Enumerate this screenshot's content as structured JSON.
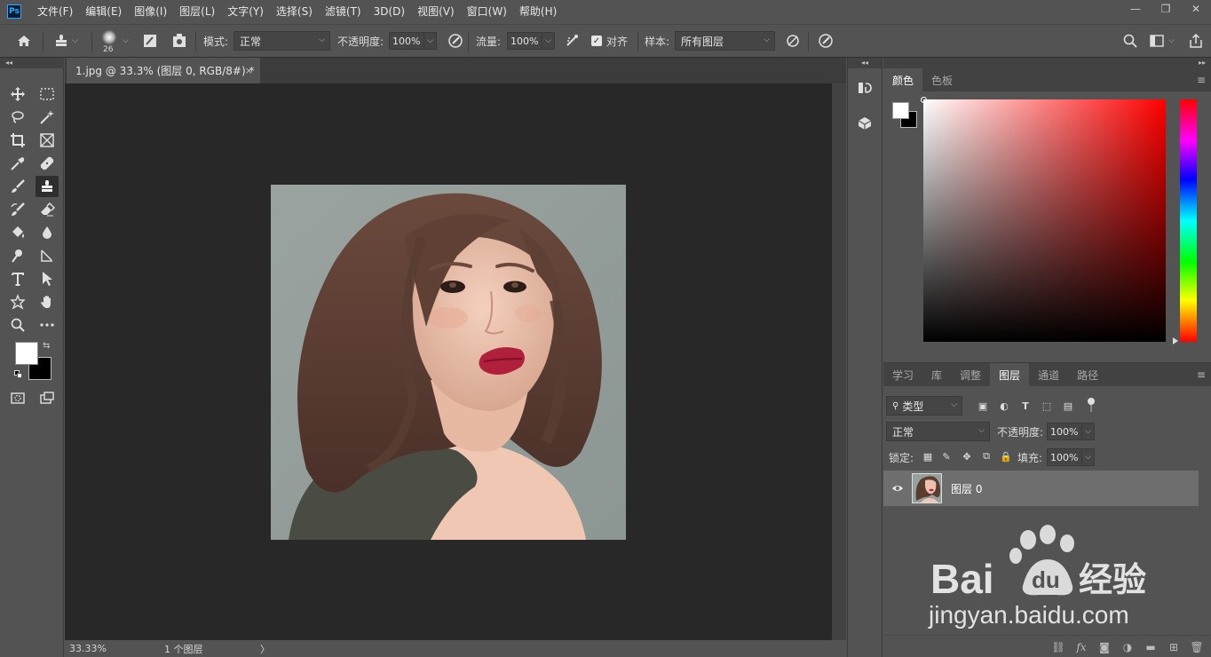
{
  "app": {
    "logo_text": "Ps"
  },
  "menu": {
    "items": [
      "文件(F)",
      "编辑(E)",
      "图像(I)",
      "图层(L)",
      "文字(Y)",
      "选择(S)",
      "滤镜(T)",
      "3D(D)",
      "视图(V)",
      "窗口(W)",
      "帮助(H)"
    ]
  },
  "window_controls": {
    "minimize": "—",
    "restore": "❐",
    "close": "✕"
  },
  "options_bar": {
    "brush_size": "26",
    "mode_label": "模式:",
    "mode_value": "正常",
    "opacity_label": "不透明度:",
    "opacity_value": "100%",
    "flow_label": "流量:",
    "flow_value": "100%",
    "aligned_checked": true,
    "aligned_label": "对齐",
    "sample_label": "样本:",
    "sample_value": "所有图层"
  },
  "document": {
    "tab_title": "1.jpg @ 33.3% (图层 0, RGB/8#) *",
    "close_glyph": "×"
  },
  "status_bar": {
    "zoom": "33.33%",
    "info": "1 个图层",
    "arrow": "〉"
  },
  "tools": {
    "active": "clone-stamp-tool",
    "foreground_color": "#ffffff",
    "background_color": "#000000"
  },
  "color_panel": {
    "tabs": [
      "颜色",
      "色板"
    ],
    "active_tab": "颜色",
    "hue_color": "#ff0000"
  },
  "layers_panel": {
    "tabs": [
      "学习",
      "库",
      "调整",
      "图层",
      "通道",
      "路径"
    ],
    "active_tab": "图层",
    "filter_label": "类型",
    "blend_mode": "正常",
    "opacity_label": "不透明度:",
    "opacity_value": "100%",
    "lock_label": "锁定:",
    "fill_label": "填充:",
    "fill_value": "100%",
    "layers": [
      {
        "name": "图层 0",
        "visible": true
      }
    ],
    "fx_label": "fx"
  },
  "watermark": {
    "brand": "Baidu经验",
    "url": "jingyan.baidu.com"
  }
}
